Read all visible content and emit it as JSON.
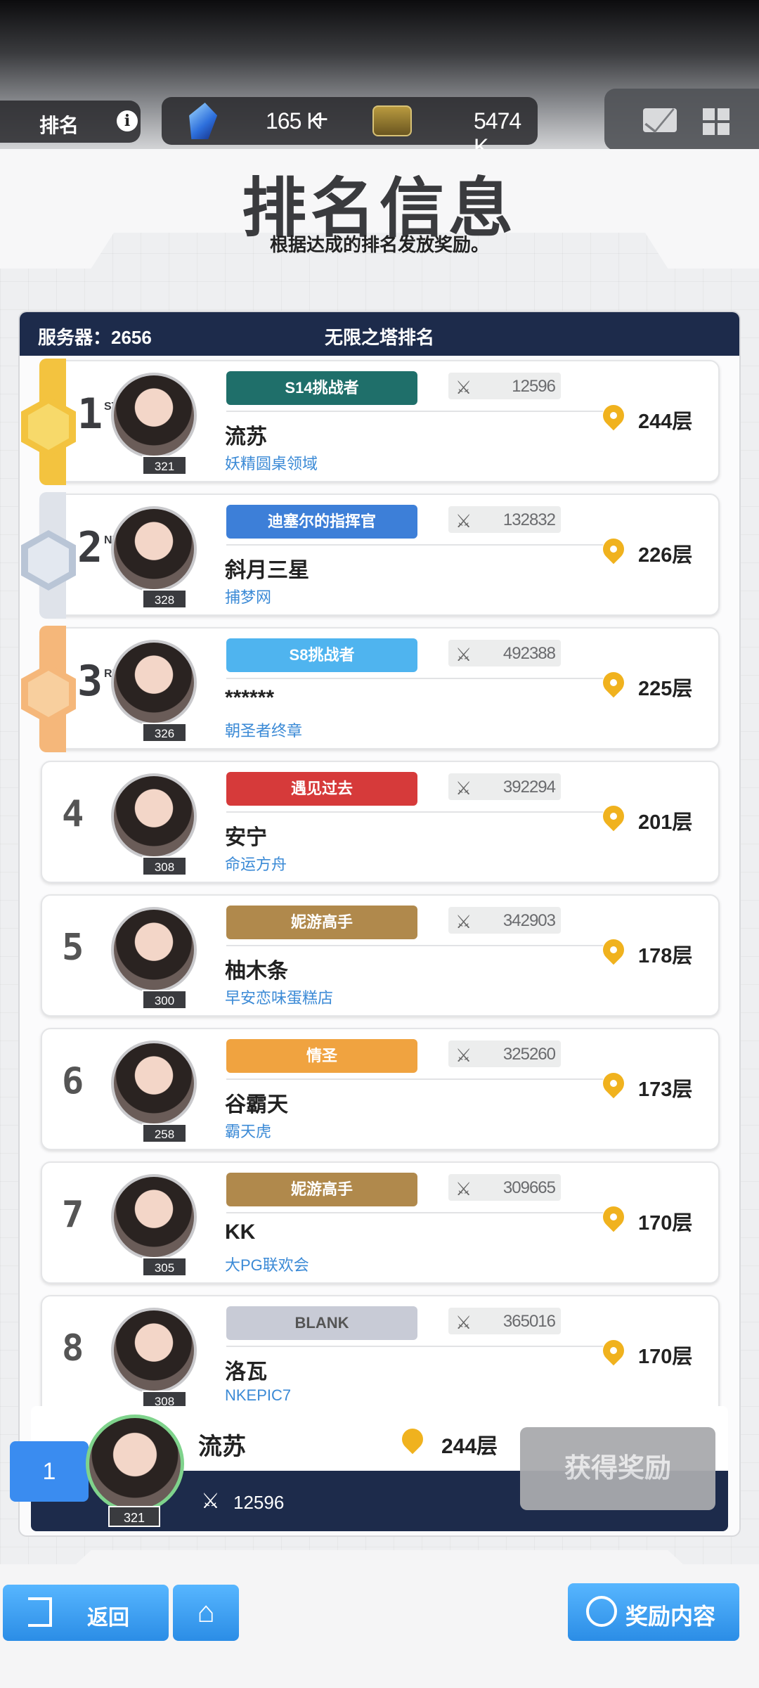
{
  "topbar": {
    "section_label": "排名",
    "info_icon": "i",
    "crystal_amount": "165 K",
    "plus": "+",
    "chip_amount": "5474 K",
    "icons": [
      "mail-icon",
      "grid-menu-icon"
    ]
  },
  "header": {
    "title": "排名信息",
    "subtitle": "根据达成的排名发放奖励。"
  },
  "list": {
    "server_label": "服务器：2656",
    "title": "无限之塔排名",
    "rows": [
      {
        "rank": "1",
        "suffix": "ST",
        "level": "321",
        "badge": "S14挑战者",
        "name": "流苏",
        "guild": "妖精圆桌领域",
        "power": "12596",
        "floor": "244层"
      },
      {
        "rank": "2",
        "suffix": "ND",
        "level": "328",
        "badge": "迪塞尔的指挥官",
        "name": "斜月三星",
        "guild": "捕梦网",
        "power": "132832",
        "floor": "226层"
      },
      {
        "rank": "3",
        "suffix": "RD",
        "level": "326",
        "badge": "S8挑战者",
        "name": "******",
        "guild": "朝圣者终章",
        "power": "492388",
        "floor": "225层"
      },
      {
        "rank": "4",
        "suffix": "",
        "level": "308",
        "badge": "遇见过去",
        "name": "安宁",
        "guild": "命运方舟",
        "power": "392294",
        "floor": "201层"
      },
      {
        "rank": "5",
        "suffix": "",
        "level": "300",
        "badge": "妮游高手",
        "name": "柚木条",
        "guild": "早安恋味蛋糕店",
        "power": "342903",
        "floor": "178层"
      },
      {
        "rank": "6",
        "suffix": "",
        "level": "258",
        "badge": "情圣",
        "name": "谷霸天",
        "guild": "霸天虎",
        "power": "325260",
        "floor": "173层"
      },
      {
        "rank": "7",
        "suffix": "",
        "level": "305",
        "badge": "妮游高手",
        "name": "KK",
        "guild": "大PG联欢会",
        "power": "309665",
        "floor": "170层"
      },
      {
        "rank": "8",
        "suffix": "",
        "level": "308",
        "badge": "BLANK",
        "name": "洛瓦",
        "guild": "NKEPIC7",
        "power": "365016",
        "floor": "170层"
      }
    ]
  },
  "self": {
    "rank": "1",
    "level": "321",
    "name": "流苏",
    "floor": "244层",
    "power": "12596",
    "claim_label": "获得奖励"
  },
  "bottom": {
    "back_label": "返回",
    "reward_label": "奖励内容"
  },
  "colors": {
    "navy": "#1d2b4b",
    "gold": "#f3c33f",
    "silver": "#b9c5d6",
    "bronze": "#f5b77a",
    "blue_button": "#3a9cf0",
    "pin": "#f0b21e",
    "guild_text": "#3b8ad6"
  }
}
